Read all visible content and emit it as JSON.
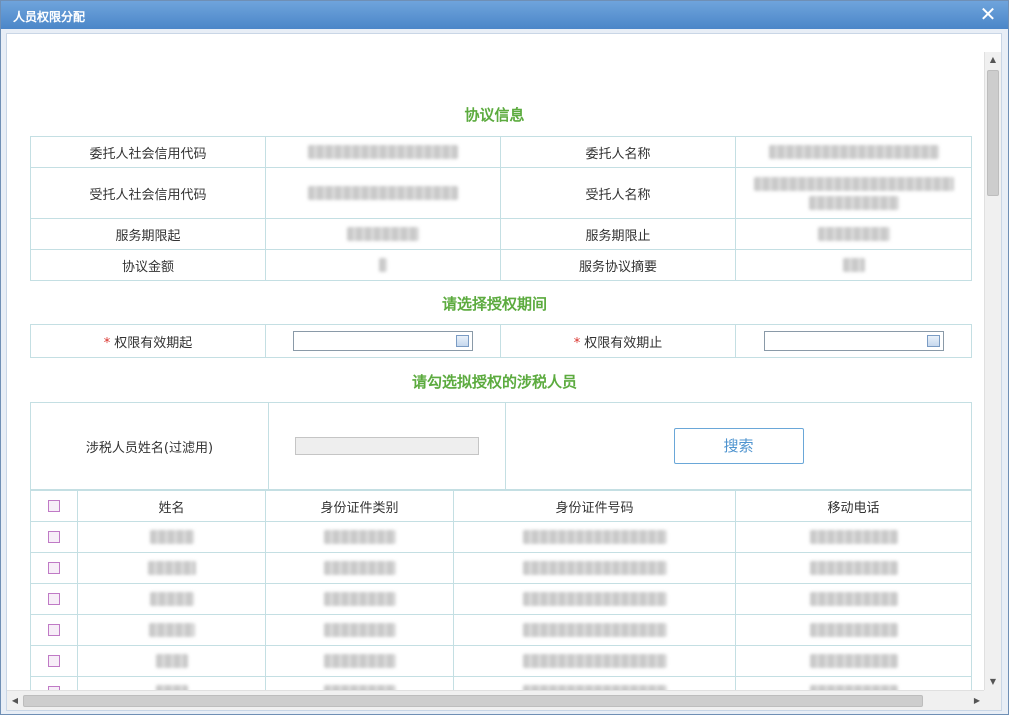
{
  "window": {
    "title": "人员权限分配"
  },
  "agreement": {
    "heading": "协议信息",
    "rows": [
      {
        "label1": "委托人社会信用代码",
        "label2": "委托人名称"
      },
      {
        "label1": "受托人社会信用代码",
        "label2": "受托人名称"
      },
      {
        "label1": "服务期限起",
        "label2": "服务期限止"
      },
      {
        "label1": "协议金额",
        "label2": "服务协议摘要"
      }
    ]
  },
  "period": {
    "heading": "请选择授权期间",
    "required_mark": "*",
    "start_label": "权限有效期起",
    "end_label": "权限有效期止",
    "start_value": "",
    "end_value": ""
  },
  "staff": {
    "heading": "请勾选拟授权的涉税人员",
    "filter_label": "涉税人员姓名(过滤用)",
    "filter_value": "",
    "search_label": "搜索",
    "columns": [
      "姓名",
      "身份证件类别",
      "身份证件号码",
      "移动电话"
    ],
    "row_count_visible": 6
  },
  "colors": {
    "heading": "#5cab3f",
    "titlebar": "#4b86c8",
    "required": "#d9312b",
    "border": "#c4dfe3"
  },
  "icons": [
    "close-icon",
    "calendar-icon",
    "checkbox-icon"
  ]
}
